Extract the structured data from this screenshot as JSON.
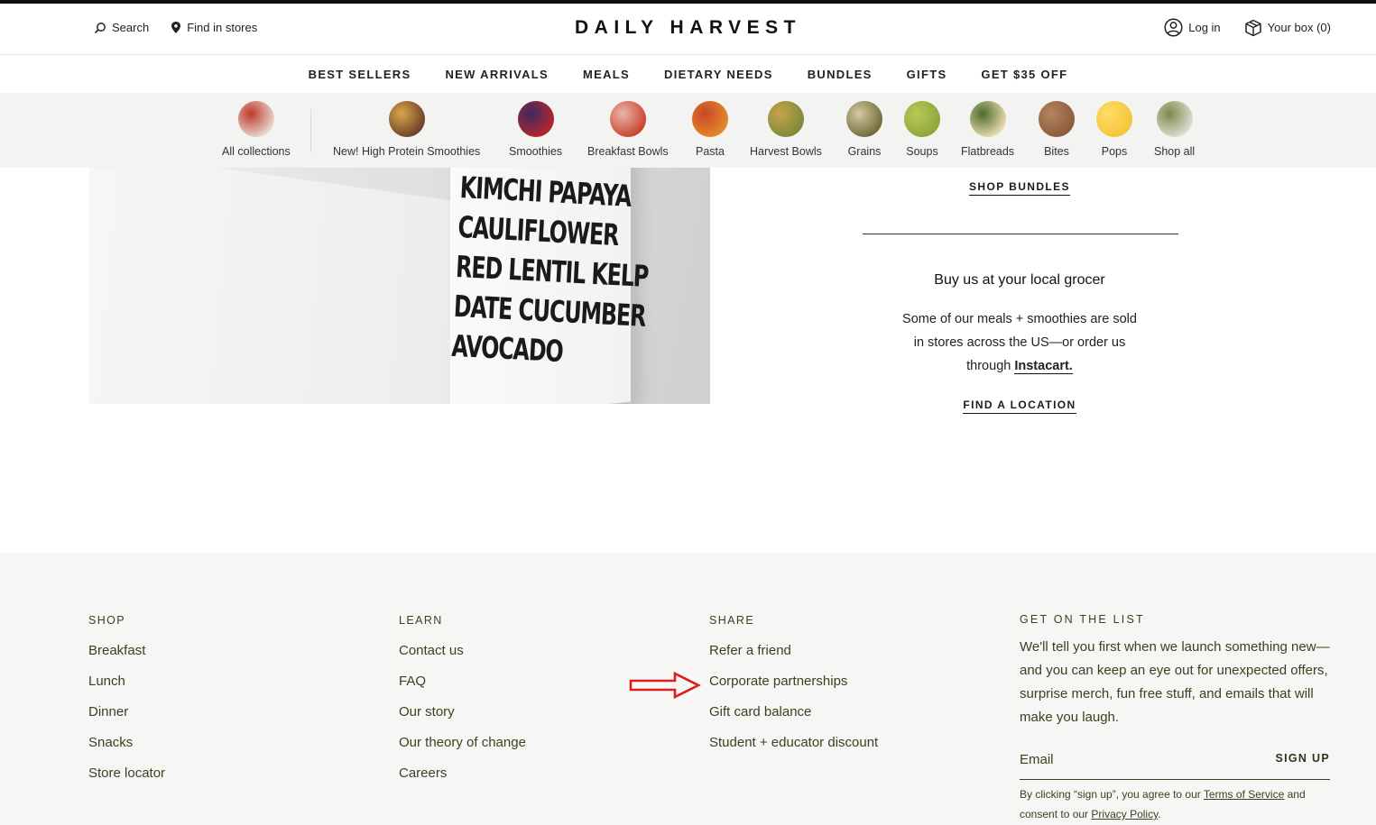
{
  "header": {
    "search_label": "Search",
    "stores_label": "Find in stores",
    "logo": "DAILY HARVEST",
    "login_label": "Log in",
    "box_label": "Your box (0)"
  },
  "nav": {
    "items": [
      "BEST SELLERS",
      "NEW ARRIVALS",
      "MEALS",
      "DIETARY NEEDS",
      "BUNDLES",
      "GIFTS",
      "GET $35 OFF"
    ]
  },
  "collections": {
    "items": [
      {
        "label": "All collections",
        "colors": [
          "#e7d9d1",
          "#c0392b"
        ]
      },
      {
        "label": "New! High Protein Smoothies",
        "colors": [
          "#6b3f2a",
          "#d9a648"
        ]
      },
      {
        "label": "Smoothies",
        "colors": [
          "#b5262b",
          "#3c2a63"
        ]
      },
      {
        "label": "Breakfast Bowls",
        "colors": [
          "#c8412e",
          "#e8b7a8"
        ]
      },
      {
        "label": "Pasta",
        "colors": [
          "#e48a2a",
          "#c9462a"
        ]
      },
      {
        "label": "Harvest Bowls",
        "colors": [
          "#7b8a3a",
          "#c9a24a"
        ]
      },
      {
        "label": "Grains",
        "colors": [
          "#6f6a3a",
          "#d6c9a0"
        ]
      },
      {
        "label": "Soups",
        "colors": [
          "#8ca63a",
          "#b9c85a"
        ]
      },
      {
        "label": "Flatbreads",
        "colors": [
          "#e8dcb0",
          "#4d6b2a"
        ]
      },
      {
        "label": "Bites",
        "colors": [
          "#8a5a3a",
          "#b58560"
        ]
      },
      {
        "label": "Pops",
        "colors": [
          "#f5c43a",
          "#ffdd66"
        ]
      },
      {
        "label": "Shop all",
        "colors": [
          "#e0ddd5",
          "#7a8a4a"
        ]
      }
    ]
  },
  "hero": {
    "bag_words": [
      "KIMCHI PAPAYA",
      "CAULIFLOWER",
      "RED LENTIL KELP",
      "DATE CUCUMBER",
      "AVOCADO"
    ]
  },
  "bundles": {
    "shop_bundles": "SHOP BUNDLES"
  },
  "grocer": {
    "title": "Buy us at your local grocer",
    "line1": "Some of our meals + smoothies are sold",
    "line2": "in stores across the US—or order us",
    "line3_prefix": "through",
    "instacart": "Instacart.",
    "find_location": "FIND A LOCATION"
  },
  "footer": {
    "shop": {
      "heading": "SHOP",
      "links": [
        "Breakfast",
        "Lunch",
        "Dinner",
        "Snacks",
        "Store locator"
      ]
    },
    "learn": {
      "heading": "LEARN",
      "links": [
        "Contact us",
        "FAQ",
        "Our story",
        "Our theory of change",
        "Careers"
      ]
    },
    "share": {
      "heading": "SHARE",
      "links": [
        "Refer a friend",
        "Corporate partnerships",
        "Gift card balance",
        "Student + educator discount"
      ]
    },
    "list": {
      "heading": "GET ON THE LIST",
      "body": "We'll tell you first when we launch something new—and you can keep an eye out for unexpected offers, surprise merch, fun free stuff, and emails that will make you laugh.",
      "email_placeholder": "Email",
      "signup_label": "SIGN UP",
      "legal_prefix": "By clicking “sign up”, you agree to our",
      "terms": "Terms of Service",
      "legal_mid": "and consent to our",
      "privacy": "Privacy Policy",
      "legal_end": "."
    }
  },
  "annotation": {
    "arrow_color": "#d62020"
  }
}
